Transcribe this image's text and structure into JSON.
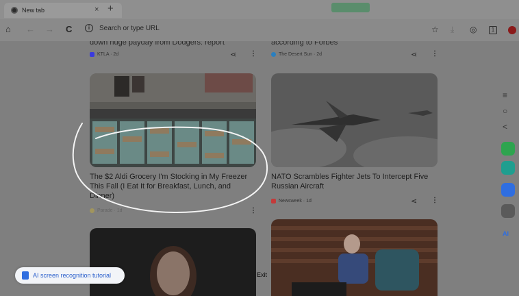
{
  "tab": {
    "title": "New tab",
    "close": "×",
    "new": "+"
  },
  "nav": {
    "home": "⌂",
    "back": "←",
    "forward": "→",
    "reload": "C",
    "url_placeholder": "Search or type URL",
    "info": "i",
    "star": "☆",
    "download": "⤓",
    "account": "◎",
    "tabs_count": "1"
  },
  "feed": {
    "left_prev_title": "down huge payday from Dodgers: report",
    "left_prev_source": "KTLA · 2d",
    "right_prev_title": "according to Forbes",
    "right_prev_source": "The Desert Sun · 2d",
    "card1_title": "The $2 Aldi Grocery I'm Stocking in My Freezer This Fall (I Eat It for Breakfast, Lunch, and Dinner)",
    "card1_source": "Parade · 1d",
    "card2_title": "NATO Scrambles Fighter Jets To Intercept Five Russian Aircraft",
    "card2_source": "Newsweek · 1d",
    "share": "⋖",
    "more": "⋮"
  },
  "overlay": {
    "ai_label": "AI screen recognition tutorial",
    "exit": "Exit"
  },
  "side": {
    "menu": "≡",
    "circle": "○",
    "back": "<",
    "ai": "AI"
  },
  "colors": {
    "green": "#2ea44f",
    "teal": "#1f9e8f",
    "blue": "#2f6ee0",
    "gray": "#5a5a5a",
    "highlight": "#ffffff"
  }
}
